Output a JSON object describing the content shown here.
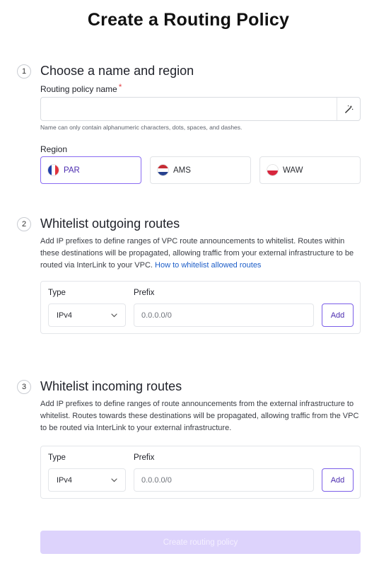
{
  "page": {
    "title": "Create a Routing Policy"
  },
  "step1": {
    "number": "1",
    "title": "Choose a name and region",
    "name_label": "Routing policy name",
    "required_mark": "*",
    "name_value": "",
    "name_placeholder": "",
    "helper": "Name can only contain alphanumeric characters, dots, spaces, and dashes.",
    "region_label": "Region",
    "regions": [
      {
        "code": "PAR",
        "selected": true,
        "flag": [
          "#1f3fa6",
          "#ffffff",
          "#e0313c"
        ]
      },
      {
        "code": "AMS",
        "selected": false,
        "flag": [
          "#c62b34",
          "#ffffff",
          "#26418f"
        ]
      },
      {
        "code": "WAW",
        "selected": false,
        "flag": [
          "#ffffff",
          "#d7263d"
        ]
      }
    ]
  },
  "step2": {
    "number": "2",
    "title": "Whitelist outgoing routes",
    "description": "Add IP prefixes to define ranges of VPC route announcements to whitelist. Routes within these destinations will be propagated, allowing traffic from your external infrastructure to be routed via InterLink to your VPC.",
    "link": "How to whitelist allowed routes",
    "type_label": "Type",
    "type_value": "IPv4",
    "prefix_label": "Prefix",
    "prefix_placeholder": "0.0.0.0/0",
    "add_label": "Add"
  },
  "step3": {
    "number": "3",
    "title": "Whitelist incoming routes",
    "description": "Add IP prefixes to define ranges of route announcements from the external infrastructure to whitelist. Routes towards these destinations will be propagated, allowing traffic from the VPC to be routed via InterLink to your external infrastructure.",
    "type_label": "Type",
    "type_value": "IPv4",
    "prefix_label": "Prefix",
    "prefix_placeholder": "0.0.0.0/0",
    "add_label": "Add"
  },
  "submit": {
    "label": "Create routing policy",
    "disabled": true
  },
  "colors": {
    "accent": "#7b5ee8",
    "accent_text": "#4c2db0",
    "link": "#1d5ec8",
    "disabled_bg": "#ddd3fc",
    "required": "#e5484d"
  }
}
